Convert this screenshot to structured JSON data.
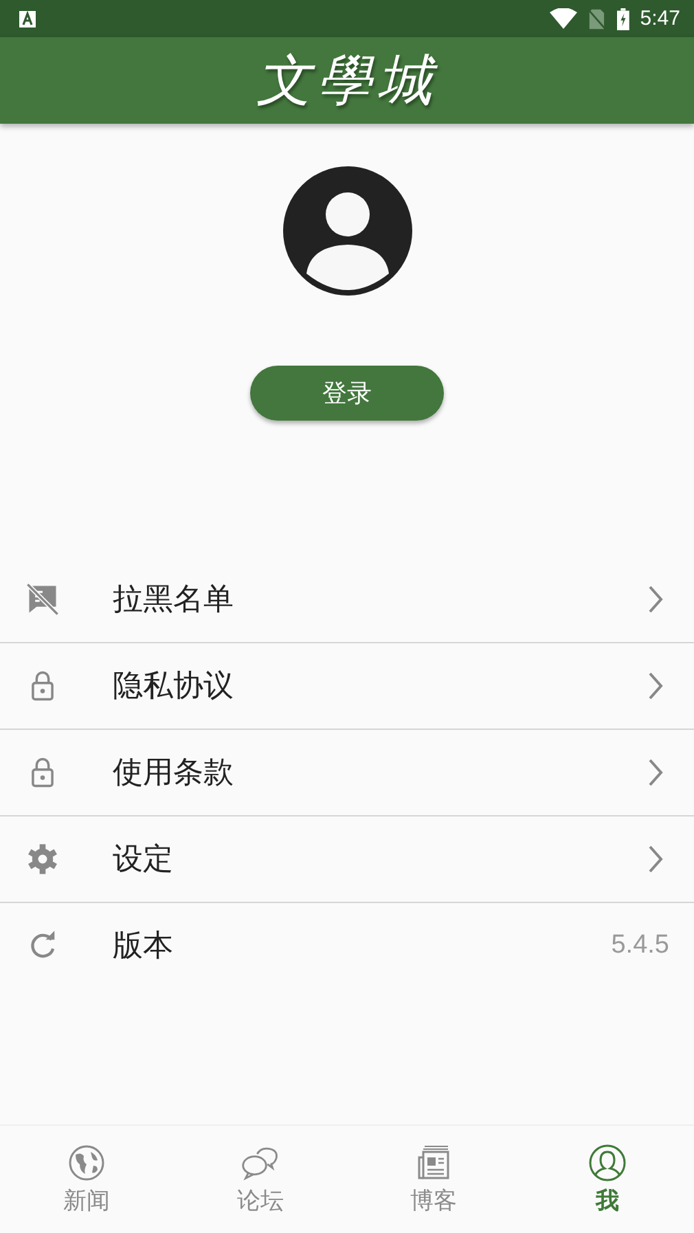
{
  "status_bar": {
    "time": "5:47"
  },
  "header": {
    "logo": "文學城"
  },
  "profile": {
    "login_button": "登录"
  },
  "menu": [
    {
      "kind": "link",
      "label": "拉黑名单"
    },
    {
      "kind": "link",
      "label": "隐私协议"
    },
    {
      "kind": "link",
      "label": "使用条款"
    },
    {
      "kind": "link",
      "label": "设定"
    },
    {
      "kind": "value",
      "label": "版本",
      "value": "5.4.5"
    }
  ],
  "tabs": [
    {
      "label": "新闻",
      "selected": false
    },
    {
      "label": "论坛",
      "selected": false
    },
    {
      "label": "博客",
      "selected": false
    },
    {
      "label": "我",
      "selected": true
    }
  ]
}
